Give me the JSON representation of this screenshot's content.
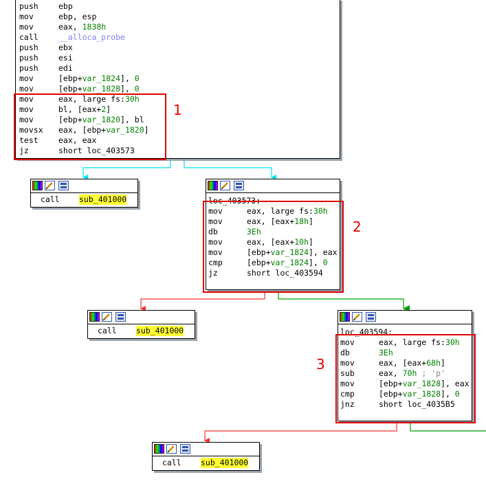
{
  "main_block": {
    "lines": [
      {
        "mn": "push",
        "op": [
          {
            "t": "ebp"
          }
        ]
      },
      {
        "mn": "mov",
        "op": [
          {
            "t": "ebp, esp"
          }
        ]
      },
      {
        "mn": "mov",
        "op": [
          {
            "t": "eax, "
          },
          {
            "t": "1838h",
            "c": "num"
          }
        ]
      },
      {
        "mn": "call",
        "op": [
          {
            "t": "__alloca_probe",
            "c": "fn"
          }
        ]
      },
      {
        "mn": "push",
        "op": [
          {
            "t": "ebx"
          }
        ]
      },
      {
        "mn": "push",
        "op": [
          {
            "t": "esi"
          }
        ]
      },
      {
        "mn": "push",
        "op": [
          {
            "t": "edi"
          }
        ]
      },
      {
        "mn": "mov",
        "op": [
          {
            "t": "[ebp+"
          },
          {
            "t": "var_1824",
            "c": "var"
          },
          {
            "t": "], "
          },
          {
            "t": "0",
            "c": "num"
          }
        ]
      },
      {
        "mn": "mov",
        "op": [
          {
            "t": "[ebp+"
          },
          {
            "t": "var_1828",
            "c": "var"
          },
          {
            "t": "], "
          },
          {
            "t": "0",
            "c": "num"
          }
        ]
      },
      {
        "mn": "mov",
        "op": [
          {
            "t": "eax, large fs:"
          },
          {
            "t": "30h",
            "c": "num"
          }
        ]
      },
      {
        "mn": "mov",
        "op": [
          {
            "t": "bl, [eax+"
          },
          {
            "t": "2",
            "c": "num"
          },
          {
            "t": "]"
          }
        ]
      },
      {
        "mn": "mov",
        "op": [
          {
            "t": "[ebp+"
          },
          {
            "t": "var_1820",
            "c": "var"
          },
          {
            "t": "], bl"
          }
        ]
      },
      {
        "mn": "movsx",
        "op": [
          {
            "t": "eax, [ebp+"
          },
          {
            "t": "var_1820",
            "c": "var"
          },
          {
            "t": "]"
          }
        ]
      },
      {
        "mn": "test",
        "op": [
          {
            "t": "eax, eax"
          }
        ]
      },
      {
        "mn": "jz",
        "op": [
          {
            "t": "short loc_403573"
          }
        ]
      }
    ]
  },
  "call_a": {
    "mn": "call",
    "target": "sub_401000"
  },
  "block2": {
    "label": "loc_403573:",
    "lines": [
      {
        "mn": "mov",
        "op": [
          {
            "t": "eax, large fs:"
          },
          {
            "t": "30h",
            "c": "num"
          }
        ]
      },
      {
        "mn": "mov",
        "op": [
          {
            "t": "eax, [eax+"
          },
          {
            "t": "18h",
            "c": "num"
          },
          {
            "t": "]"
          }
        ]
      },
      {
        "mn": "db",
        "op": [
          {
            "t": "3Eh",
            "c": "num"
          }
        ]
      },
      {
        "mn": "mov",
        "op": [
          {
            "t": "eax, [eax+"
          },
          {
            "t": "10h",
            "c": "num"
          },
          {
            "t": "]"
          }
        ]
      },
      {
        "mn": "mov",
        "op": [
          {
            "t": "[ebp+"
          },
          {
            "t": "var_1824",
            "c": "var"
          },
          {
            "t": "], eax"
          }
        ]
      },
      {
        "mn": "cmp",
        "op": [
          {
            "t": "[ebp+"
          },
          {
            "t": "var_1824",
            "c": "var"
          },
          {
            "t": "], "
          },
          {
            "t": "0",
            "c": "num"
          }
        ]
      },
      {
        "mn": "jz",
        "op": [
          {
            "t": "short loc_403594"
          }
        ]
      }
    ]
  },
  "call_b": {
    "mn": "call",
    "target": "sub_401000"
  },
  "block3": {
    "label": "loc_403594:",
    "lines": [
      {
        "mn": "mov",
        "op": [
          {
            "t": "eax, large fs:"
          },
          {
            "t": "30h",
            "c": "num"
          }
        ]
      },
      {
        "mn": "db",
        "op": [
          {
            "t": "3Eh",
            "c": "num"
          }
        ]
      },
      {
        "mn": "mov",
        "op": [
          {
            "t": "eax, [eax+"
          },
          {
            "t": "68h",
            "c": "num"
          },
          {
            "t": "]"
          }
        ]
      },
      {
        "mn": "sub",
        "op": [
          {
            "t": "eax, "
          },
          {
            "t": "70h",
            "c": "num"
          },
          {
            "t": " ; 'p'",
            "c": "str"
          }
        ]
      },
      {
        "mn": "mov",
        "op": [
          {
            "t": "[ebp+"
          },
          {
            "t": "var_1828",
            "c": "var"
          },
          {
            "t": "], eax"
          }
        ]
      },
      {
        "mn": "cmp",
        "op": [
          {
            "t": "[ebp+"
          },
          {
            "t": "var_1828",
            "c": "var"
          },
          {
            "t": "], "
          },
          {
            "t": "0",
            "c": "num"
          }
        ]
      },
      {
        "mn": "jnz",
        "op": [
          {
            "t": "short loc_4035B5"
          }
        ]
      }
    ]
  },
  "call_c": {
    "mn": "call",
    "target": "sub_401000"
  },
  "annotations": [
    "1",
    "2",
    "3"
  ],
  "colors": {
    "edge_unconditional": "#00e0f0",
    "edge_true": "#00a000",
    "edge_false": "#ff3030",
    "highlight_box": "#e00000",
    "symbol_highlight": "#ffff33"
  }
}
